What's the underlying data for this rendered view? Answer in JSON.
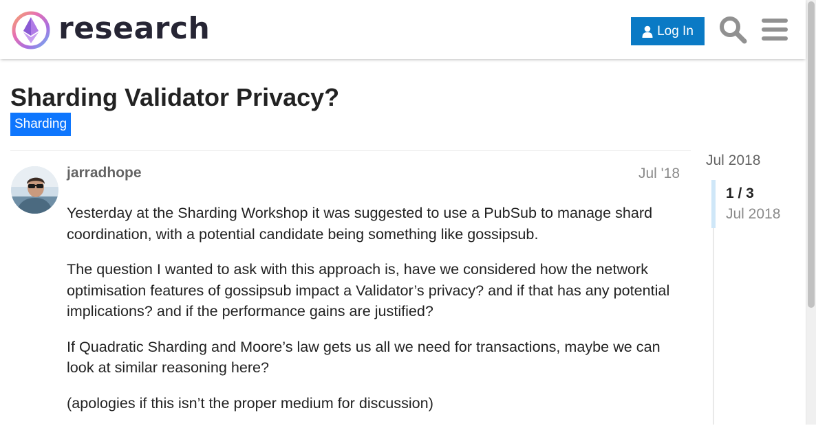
{
  "header": {
    "site_name": "research",
    "login_label": "Log In"
  },
  "topic": {
    "title": "Sharding Validator Privacy?",
    "category": "Sharding"
  },
  "post": {
    "username": "jarradhope",
    "date": "Jul '18",
    "paragraphs": [
      "Yesterday at the Sharding Workshop it was suggested to use a PubSub to manage shard coordination, with a potential candidate being something like gossipsub.",
      "The question I wanted to ask with this approach is, have we considered how the network optimisation features of gossipsub impact a Validator’s privacy? and if that has any potential implications? and if the performance gains are justified?",
      "If Quadratic Sharding and Moore’s law gets us all we need for transactions, maybe we can look at similar reasoning here?",
      "(apologies if this isn’t the proper medium for discussion)"
    ]
  },
  "timeline": {
    "start_date": "Jul 2018",
    "position": "1 / 3",
    "current_date": "Jul 2018"
  },
  "colors": {
    "login_button": "#0a7ac5",
    "category_badge": "#0e76fd",
    "timeline_handle": "#cfe7f8"
  },
  "icons": [
    "ethereum-logo-icon",
    "user-icon",
    "search-icon",
    "hamburger-menu-icon"
  ]
}
